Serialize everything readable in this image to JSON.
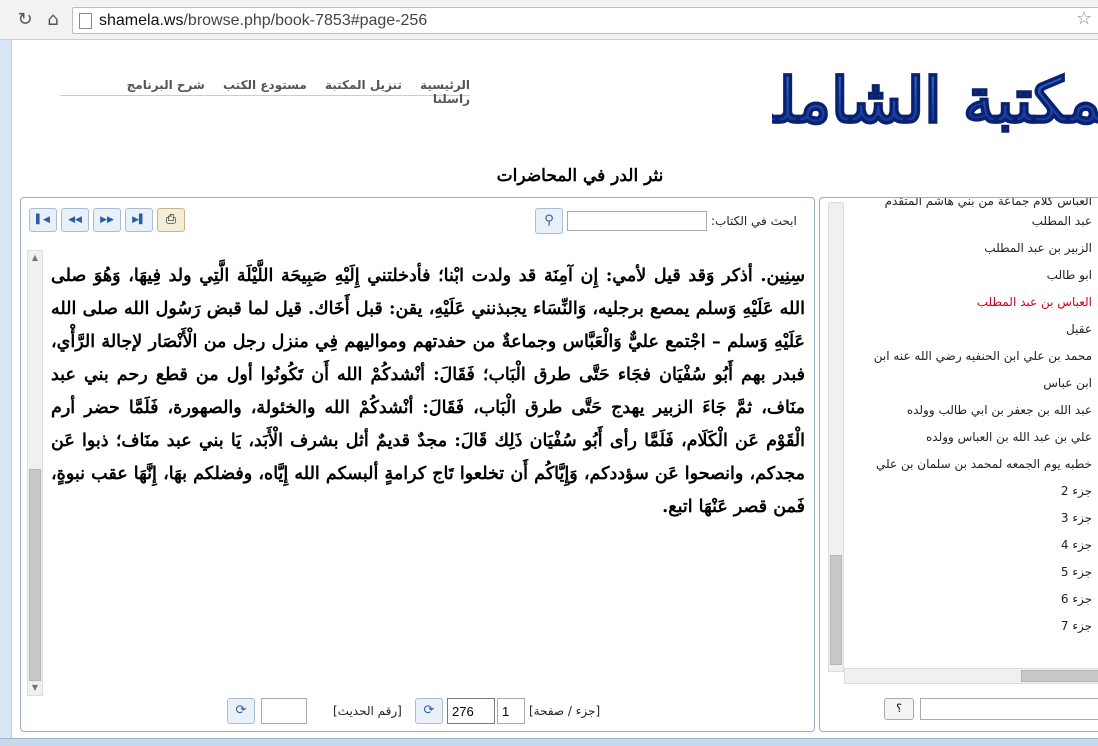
{
  "browser": {
    "url_host": "shamela.ws",
    "url_path": "/browse.php/book-7853#page-256"
  },
  "header": {
    "nav": [
      "الرئيسية",
      "تنزيل المكتبة",
      "مستودع الكتب",
      "شرح البرنامج",
      "راسلنا"
    ],
    "logo_text": "المكتبة الشاملة",
    "book_title": "نثر الدر في المحاضرات"
  },
  "toolbar": {
    "search_label": "ابحث في الكتاب:",
    "search_value": ""
  },
  "content": {
    "text": "سِنِين. أذكر وَقد قيل لأمي: إِن آمِنَة قد ولدت ابْنا؛ فأدخلتني إِلَيْهِ صَبِيحَة اللَّيْلَة الَّتِي ولد فِيهَا، وَهُوَ صلى الله عَلَيْهِ وَسلم يمصع برجليه، وَالنِّسَاء يجبذنني عَلَيْهِ، يقن: قبل أَخَاك. قيل لما قبض رَسُول الله صلى الله عَلَيْهِ وَسلم – اجْتمع عليٌّ وَالْعَبَّاس وجماعةٌ من حفدتهم ومواليهم فِي منزل رجل من الْأَنْصَار لإجالة الرَّأْي، فبدر بهم أَبُو سُفْيَان فجَاء حَتَّى طرق الْبَاب؛ فَقَالَ: أنْشدكُمْ الله أَن تَكُونُوا أول من قطع رحم بني عبد منَاف، ثمَّ جَاءَ الزبير يهدج حَتَّى طرق الْبَاب، فَقَالَ: أنْشدكُمْ الله والخئولة، والصهورة، فَلَمَّا حضر أرم الْقَوْم عَن الْكَلَام، فَلَمَّا رأى أَبُو سُفْيَان ذَلِك قَالَ: مجدٌ قديمٌ أثل بشرف الْأَبَد، يَا بني عبد منَاف؛ ذبوا عَن مجدكم، وانصحوا عَن سؤددكم، وَإِيَّاكُم أَن تخلعوا تَاج كرامةٍ ألبسكم الله إِيَّاه، وفضلكم بهَا، إِنَّهَا عقب نبوةٍ، فَمن قصر عَنْهَا اتبع."
  },
  "pager": {
    "label": "[جزء / صفحة]",
    "part": "1",
    "page": "276",
    "hadith_label": "[رقم الحديث]",
    "hadith_value": ""
  },
  "toc": {
    "cut_item": "العباس كلام جماعة من بني هاشم المتقدم",
    "items": [
      "عبد المطلب",
      "الزبير بن عبد المطلب",
      "ابو طالب",
      "العباس بن عبد المطلب",
      "عقيل",
      "محمد بن علي ابن الحنفيه رضي الله عنه ابن",
      "ابن عباس",
      "عبد الله بن جعفر بن ابي طالب وولده",
      "علي بن عبد الله بن العباس وولده",
      "خطبه يوم الجمعه لمحمد بن سلمان بن علي"
    ],
    "active_index": 3,
    "parts": [
      "جزء 2",
      "جزء 3",
      "جزء 4",
      "جزء 5",
      "جزء 6",
      "جزء 7"
    ],
    "help_label": "؟"
  }
}
